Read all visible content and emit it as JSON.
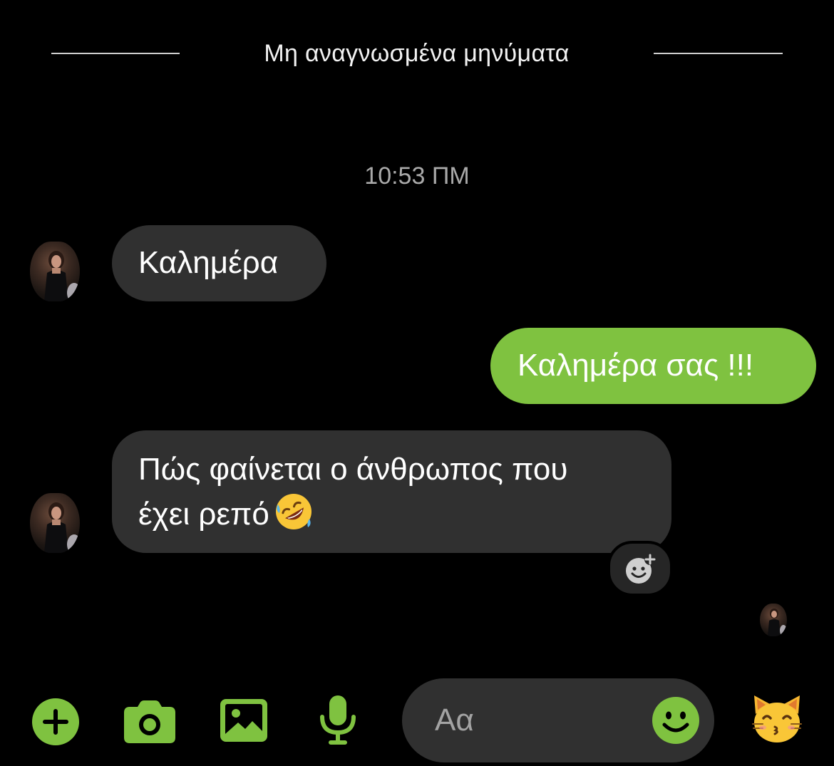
{
  "divider": {
    "label": "Μη αναγνωσμένα μηνύματα"
  },
  "timestamp": "10:53 ΠΜ",
  "messages": [
    {
      "direction": "incoming",
      "text": "Καλημέρα"
    },
    {
      "direction": "outgoing",
      "text": "Καλημέρα σας !!!"
    },
    {
      "direction": "incoming",
      "lines": [
        "Πώς φαίνεται ο άνθρωπος που",
        "έχει ρεπό"
      ],
      "emoji": "rolling-on-floor-laughing"
    }
  ],
  "composer": {
    "placeholder": "Αα",
    "tools": [
      "plus-icon",
      "camera-icon",
      "image-icon",
      "microphone-icon"
    ],
    "emoji_button": "smile-icon",
    "quick_reaction": "kissing-cat-emoji"
  },
  "colors": {
    "accent": "#7fc240",
    "incoming_bubble": "#303030",
    "background": "#000000"
  }
}
